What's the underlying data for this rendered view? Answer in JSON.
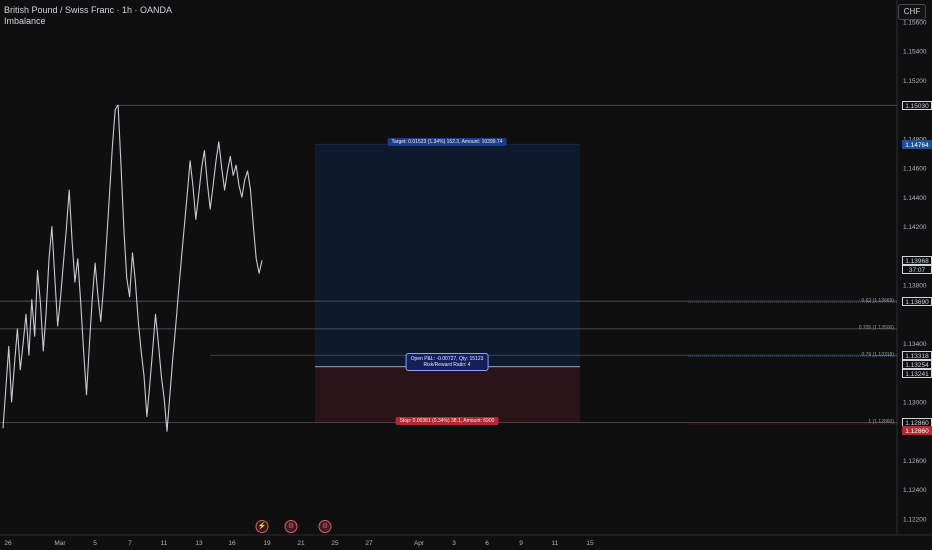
{
  "header": {
    "symbol_line": "British Pound / Swiss Franc · 1h · OANDA",
    "indicator": "Imbalance",
    "currency": "CHF"
  },
  "chart_data": {
    "type": "line",
    "title": "British Pound / Swiss Franc · 1h · OANDA",
    "series": [
      {
        "values": [
          1.1282,
          1.131,
          1.1338,
          1.13,
          1.1326,
          1.135,
          1.1322,
          1.134,
          1.136,
          1.1332,
          1.137,
          1.1345,
          1.139,
          1.1368,
          1.1335,
          1.1362,
          1.1398,
          1.142,
          1.1385,
          1.1352,
          1.1372,
          1.1395,
          1.1418,
          1.1445,
          1.141,
          1.1382,
          1.1398,
          1.1368,
          1.1335,
          1.1305,
          1.1338,
          1.137,
          1.1395,
          1.1372,
          1.1355,
          1.138,
          1.141,
          1.1442,
          1.1475,
          1.15,
          1.1503,
          1.1462,
          1.1418,
          1.1385,
          1.1372,
          1.1402,
          1.1382,
          1.1355,
          1.1335,
          1.1318,
          1.129,
          1.1312,
          1.1335,
          1.136,
          1.134,
          1.1318,
          1.1302,
          1.128,
          1.1305,
          1.133,
          1.1352,
          1.1375,
          1.1398,
          1.142,
          1.1442,
          1.1465,
          1.1448,
          1.1425,
          1.1442,
          1.146,
          1.1472,
          1.145,
          1.1432,
          1.1448,
          1.1465,
          1.1478,
          1.146,
          1.1445,
          1.1458,
          1.1468,
          1.1455,
          1.1462,
          1.1448,
          1.144,
          1.1452,
          1.1458,
          1.1445,
          1.142,
          1.1398,
          1.1388,
          1.1397
        ]
      }
    ],
    "x_range": [
      "Feb 26",
      "Mar 19"
    ],
    "x_ticks": [
      "26",
      "Mar",
      "5",
      "7",
      "11",
      "13",
      "16",
      "19",
      "21",
      "25",
      "27",
      "Apr",
      "3",
      "6",
      "9",
      "11",
      "15"
    ],
    "y_ticks": [
      "1.15600",
      "1.15400",
      "1.15200",
      "1.14800",
      "1.14600",
      "1.14400",
      "1.14200",
      "1.13800",
      "1.13400",
      "1.13000",
      "1.12600",
      "1.12400",
      "1.12200"
    ],
    "ylim": [
      1.1209,
      1.1575
    ],
    "price_tags": [
      {
        "label": "1.15030",
        "value": 1.1503,
        "style": "outline"
      },
      {
        "label": "1.14764",
        "value": 1.14764,
        "style": "blue"
      },
      {
        "label": "1.13968",
        "value": 1.13968,
        "style": "last",
        "sub": "37:07"
      },
      {
        "label": "1.13690",
        "value": 1.1369,
        "style": "outline"
      },
      {
        "label": "1.13318",
        "value": 1.13318,
        "style": "outline"
      },
      {
        "label": "1.13254",
        "value": 1.13254,
        "style": "outline"
      },
      {
        "label": "1.13241",
        "value": 1.13241,
        "style": "outline"
      },
      {
        "label": "1.12860",
        "value": 1.1286,
        "style": "outline"
      },
      {
        "label": "1.12860",
        "value": 1.1286,
        "style": "red"
      }
    ],
    "levels": [
      {
        "value": 1.1503,
        "label": ""
      },
      {
        "value": 1.1369,
        "label": "0.62 (1.13669)"
      },
      {
        "value": 1.135,
        "label": "0.705 (1.13500)"
      },
      {
        "value": 1.1332,
        "label": "0.79 (1.13318)"
      },
      {
        "value": 1.1286,
        "label": "1 (1.12860)"
      }
    ],
    "position": {
      "entry": 1.13241,
      "target": 1.14764,
      "stop": 1.1286,
      "target_text": "Target: 0.01523 (1.34%) 152.3, Amount: 10399.74",
      "stop_text": "Stop: 0.00381 (0.34%) 38.1, Amount: 6900",
      "pnl_text": "Open P&L: -0.00727, Qty: 15123",
      "rr_text": "Risk/Reward Ratio: 4"
    },
    "events": [
      "⚡",
      "⚙",
      "⚙"
    ]
  }
}
